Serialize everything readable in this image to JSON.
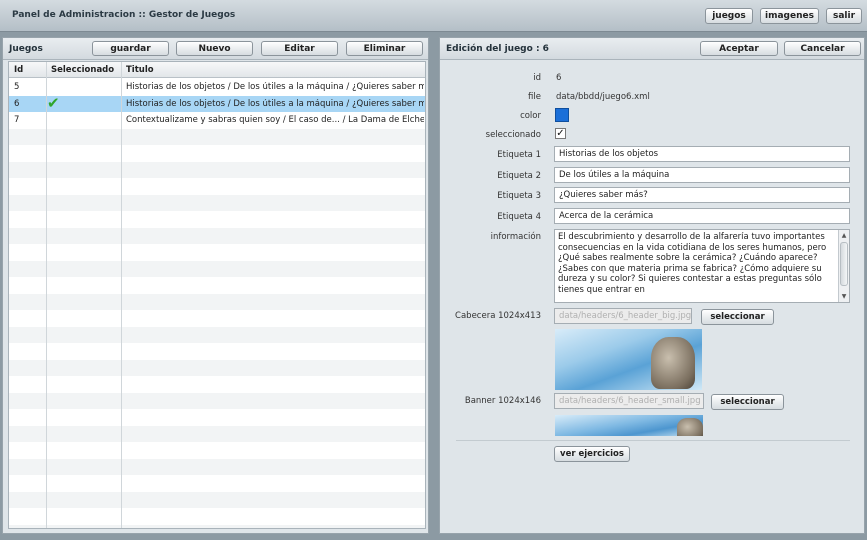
{
  "header": {
    "title": "Panel de Administracion :: Gestor de Juegos",
    "buttons": {
      "juegos": "juegos",
      "imagenes": "imagenes",
      "salir": "salir"
    }
  },
  "left_panel": {
    "title": "Juegos",
    "buttons": {
      "guardar": "guardar",
      "nuevo": "Nuevo",
      "editar": "Editar",
      "eliminar": "Eliminar"
    },
    "columns": {
      "id": "Id",
      "selected": "Seleccionado",
      "title": "Titulo"
    },
    "rows": [
      {
        "id": "5",
        "title": "Historias de los objetos / De los útiles a la máquina / ¿Quieres saber más? / Acerca de la cerámica",
        "selected": false
      },
      {
        "id": "6",
        "title": "Historias de los objetos / De los útiles a la máquina / ¿Quieres saber más? / Acerca de la cerámica",
        "selected": true
      },
      {
        "id": "7",
        "title": "Contextualizame y sabras quien soy / El caso de... / La Dama de Elche",
        "selected": false
      }
    ]
  },
  "right_panel": {
    "title": "Edición del juego : 6",
    "buttons": {
      "aceptar": "Aceptar",
      "cancelar": "Cancelar"
    },
    "labels": {
      "id": "id",
      "file": "file",
      "color": "color",
      "selected": "seleccionado",
      "tag1": "Etiqueta 1",
      "tag2": "Etiqueta 2",
      "tag3": "Etiqueta 3",
      "tag4": "Etiqueta 4",
      "info": "información",
      "header_img": "Cabecera 1024x413",
      "banner_img": "Banner 1024x146"
    },
    "values": {
      "id": "6",
      "file": "data/bbdd/juego6.xml",
      "color": "#1b6fd8",
      "selected_mark": "✓",
      "tag1": "Historias de los objetos",
      "tag2": "De los útiles a la máquina",
      "tag3": "¿Quieres saber más?",
      "tag4": "Acerca de la cerámica",
      "info": "El descubrimiento y desarrollo de la alfarería tuvo importantes consecuencias en la vida cotidiana de los seres humanos, pero ¿Qué sabes realmente sobre la cerámica? ¿Cuándo aparece? ¿Sabes con que materia prima se fabrica? ¿Cómo adquiere su dureza y su color? Si quieres contestar a estas preguntas sólo tienes que entrar en",
      "header_path": "data/headers/6_header_big.jpg",
      "banner_path": "data/headers/6_header_small.jpg"
    },
    "select_label": "seleccionar",
    "exercises_label": "ver ejercicios"
  }
}
